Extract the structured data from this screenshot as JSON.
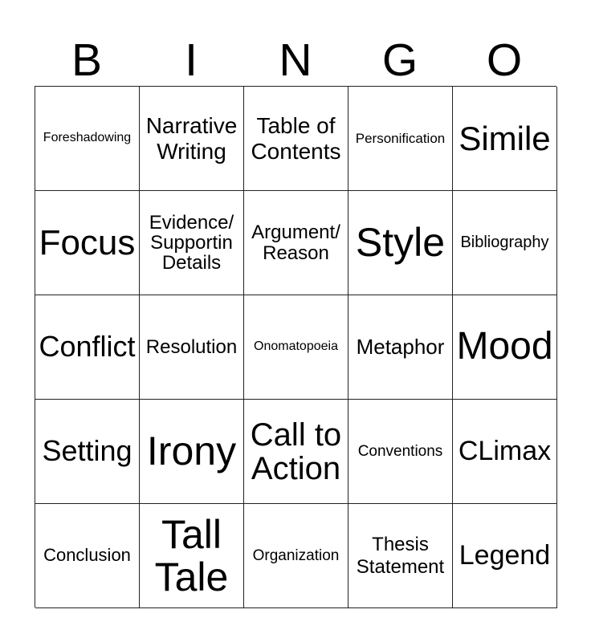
{
  "header": [
    "B",
    "I",
    "N",
    "G",
    "O"
  ],
  "board": [
    [
      "Foreshadowing",
      "Narrative\nWriting",
      "Table of\nContents",
      "Personification",
      "Simile"
    ],
    [
      "Focus",
      "Evidence/\nSupportin\nDetails",
      "Argument/\nReason",
      "Style",
      "Bibliography"
    ],
    [
      "Conflict",
      "Resolution",
      "Onomatopoeia",
      "Metaphor",
      "Mood"
    ],
    [
      "Setting",
      "Irony",
      "Call to\nAction",
      "Conventions",
      "CLimax"
    ],
    [
      "Conclusion",
      "Tall\nTale",
      "Organization",
      "Thesis\nStatement",
      "Legend"
    ]
  ]
}
